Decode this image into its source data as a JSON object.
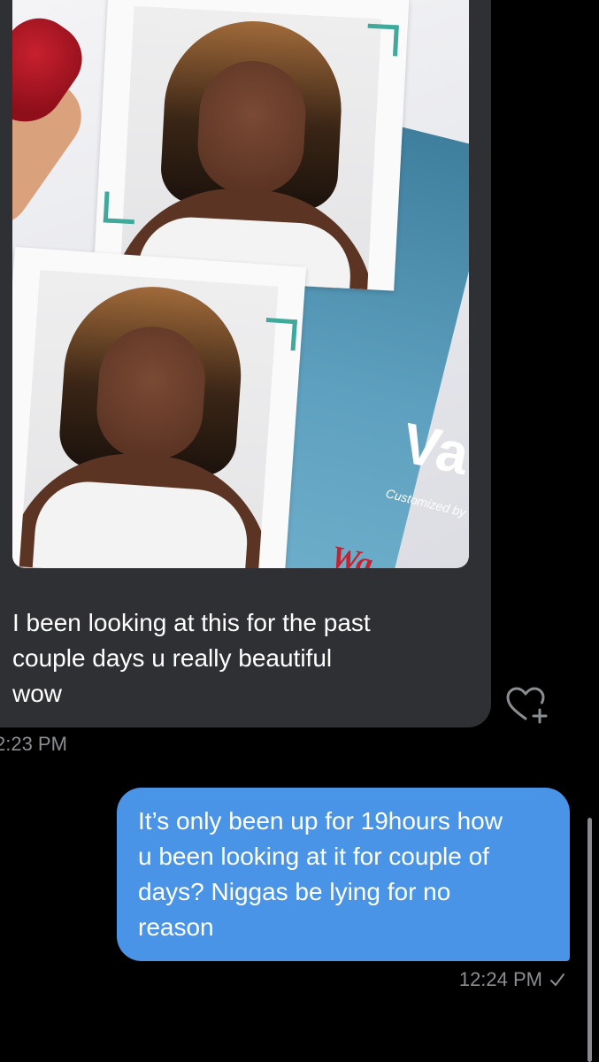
{
  "conversation": {
    "incoming": {
      "photo_label": "Va",
      "photo_sub": "Customized by",
      "photo_red_mark": "Wa",
      "text": "I been looking at this for the past\ncouple days u really beautiful\nwow",
      "time": "2:23 PM",
      "reaction_icon": "heart-plus-icon"
    },
    "outgoing": {
      "text": "It’s only been up for 19hours how\nu been looking at it for couple of\ndays? Niggas be lying for no\nreason",
      "time": "12:24 PM",
      "status_icon": "checkmark-icon"
    }
  },
  "colors": {
    "background": "#000000",
    "incoming_bubble": "#2f3033",
    "outgoing_bubble": "#4a94e8",
    "timestamp": "#8a8d91",
    "accent_teal": "#3fa99b"
  }
}
